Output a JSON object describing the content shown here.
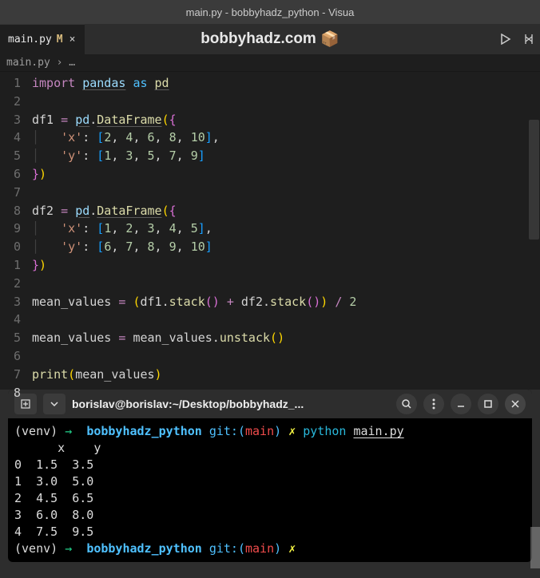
{
  "titlebar": "main.py - bobbyhadz_python - Visua",
  "tab": {
    "name": "main.py",
    "modified": "M",
    "close": "×"
  },
  "center": {
    "label": "bobbyhadz.com",
    "emoji": "📦"
  },
  "breadcrumb": {
    "file": "main.py",
    "sep": "›",
    "rest": "…"
  },
  "gutter": [
    "1",
    "2",
    "3",
    "4",
    "5",
    "6",
    "7",
    "8",
    "9",
    "0",
    "1",
    "2",
    "3",
    "4",
    "5",
    "6",
    "7",
    "8"
  ],
  "code": {
    "import_kw": "import",
    "pandas": "pandas",
    "as_kw": "as",
    "pd": "pd",
    "df1": "df1",
    "df2": "df2",
    "DataFrame": "DataFrame",
    "x_key": "'x'",
    "y_key": "'y'",
    "df1_x": [
      "2",
      "4",
      "6",
      "8",
      "10"
    ],
    "df1_y": [
      "1",
      "3",
      "5",
      "7",
      "9"
    ],
    "df2_x": [
      "1",
      "2",
      "3",
      "4",
      "5"
    ],
    "df2_y": [
      "6",
      "7",
      "8",
      "9",
      "10"
    ],
    "mean_values": "mean_values",
    "stack": "stack",
    "unstack": "unstack",
    "print": "print",
    "two": "2",
    "eq": "=",
    "plus": "+",
    "slash": "/"
  },
  "terminal": {
    "path_title": "borislav@borislav:~/Desktop/bobbyhadz_...",
    "venv": "(venv)",
    "arrow": "→",
    "project": "bobbyhadz_python",
    "git_label": "git:(",
    "branch": "main",
    "git_close": ")",
    "yel": "✗",
    "cmd": "python",
    "file": "main.py",
    "output_header": "      x    y",
    "output_rows": [
      "0  1.5  3.5",
      "1  3.0  5.0",
      "2  4.5  6.5",
      "3  6.0  8.0",
      "4  7.5  9.5"
    ]
  }
}
